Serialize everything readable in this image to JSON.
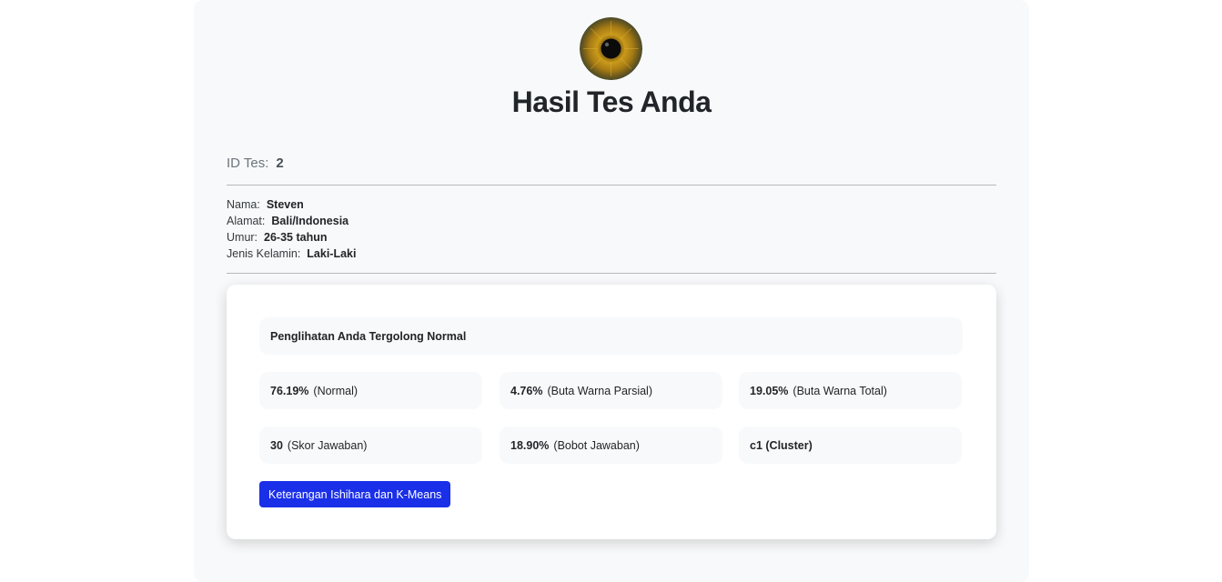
{
  "header": {
    "title": "Hasil Tes Anda"
  },
  "test": {
    "id_label": "ID Tes:",
    "id_value": "2"
  },
  "profile": {
    "name_label": "Nama:",
    "name_value": "Steven",
    "address_label": "Alamat:",
    "address_value": "Bali/Indonesia",
    "age_label": "Umur:",
    "age_value": "26-35 tahun",
    "gender_label": "Jenis Kelamin:",
    "gender_value": "Laki-Laki"
  },
  "result": {
    "summary": "Penglihatan Anda Tergolong Normal",
    "stats": [
      {
        "value": "76.19%",
        "label": "(Normal)"
      },
      {
        "value": "4.76%",
        "label": "(Buta Warna Parsial)"
      },
      {
        "value": "19.05%",
        "label": "(Buta Warna Total)"
      },
      {
        "value": "30",
        "label": "(Skor Jawaban)"
      },
      {
        "value": "18.90%",
        "label": "(Bobot Jawaban)"
      },
      {
        "value": "c1 (Cluster)",
        "label": ""
      }
    ],
    "button_label": "Keterangan Ishihara dan K-Means"
  },
  "colors": {
    "accent": "#1a2fe8",
    "panel_bg": "#f8f9fa"
  },
  "icons": {
    "avatar": "eye-iris-image"
  }
}
